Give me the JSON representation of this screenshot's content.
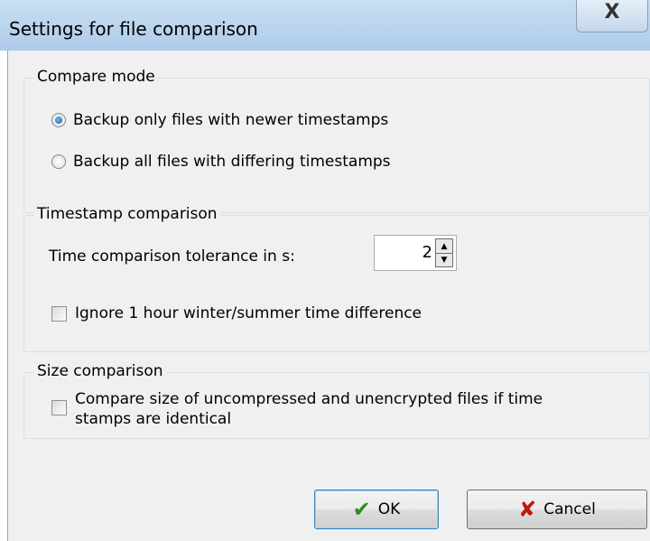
{
  "window": {
    "title": "Settings for file comparison",
    "close_glyph": "X"
  },
  "compare_mode": {
    "label": "Compare mode",
    "options": [
      {
        "label": "Backup only files with newer timestamps",
        "checked": true
      },
      {
        "label": "Backup all files with differing timestamps",
        "checked": false
      }
    ]
  },
  "timestamp": {
    "label": "Timestamp comparison",
    "tolerance_label": "Time comparison tolerance in s:",
    "tolerance_value": "2",
    "ignore_dst_label": "Ignore 1 hour winter/summer time difference"
  },
  "size": {
    "label": "Size comparison",
    "compare_label_line1": "Compare size of uncompressed and unencrypted files if time",
    "compare_label_line2": "stamps are identical"
  },
  "buttons": {
    "ok": "OK",
    "ok_icon": "checkmark-icon",
    "ok_color": "#2e8b1e",
    "cancel": "Cancel",
    "cancel_icon": "x-icon",
    "cancel_color": "#c0180c"
  }
}
